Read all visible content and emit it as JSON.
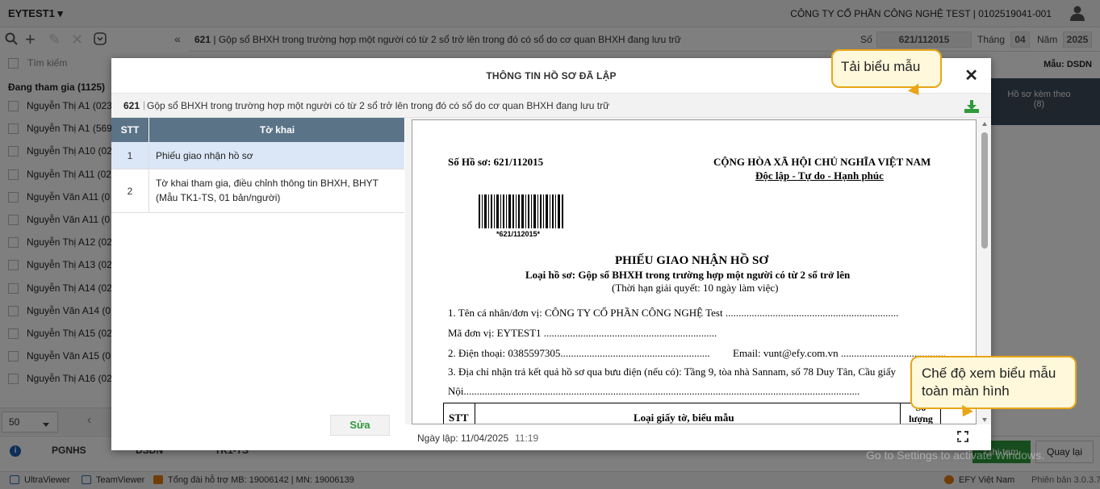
{
  "app": {
    "title": "EYTEST1",
    "company": "CÔNG TY CỔ PHẦN CÔNG NGHỆ TEST | 0102519041-001"
  },
  "doc_header": {
    "code": "621",
    "title": "Gộp sổ BHXH trong trường hợp một người có từ 2 sổ trở lên trong đó có sổ do cơ quan BHXH đang lưu trữ",
    "so_label": "Số",
    "so_value": "621/112015",
    "thang_label": "Tháng",
    "thang_value": "04",
    "nam_label": "Năm",
    "nam_value": "2025"
  },
  "sidebar": {
    "search_placeholder": "Tìm kiếm",
    "group_label": "Đang tham gia (1125)",
    "people": [
      "Nguyễn Thị A1 (023",
      "Nguyễn Thị A1 (569",
      "Nguyễn Thị A10 (02",
      "Nguyễn Thị A11 (02",
      "Nguyễn Văn A11 (0",
      "Nguyễn Văn A11 (0",
      "Nguyễn Thị A12 (02",
      "Nguyễn Thị A13 (02",
      "Nguyễn Thị A14 (02",
      "Nguyễn Văn A14 (0",
      "Nguyễn Thị A15 (02",
      "Nguyễn Văn A15 (0",
      "Nguyễn Thị A16 (02"
    ],
    "page_size": "50"
  },
  "right_pane": {
    "mau_label": "Mẫu: DSDN",
    "attach_label": "Hồ sơ kèm theo",
    "attach_count": "(8)"
  },
  "bottom_tabs": [
    "PGNHS",
    "DSDN",
    "TK1-TS"
  ],
  "bottom_buttons": {
    "save": "Ghi tạm",
    "back": "Quay lại"
  },
  "statusbar": {
    "ultraviewer": "UltraViewer",
    "teamviewer": "TeamViewer",
    "support": "Tổng đài hỗ trợ MB: 19006142 | MN: 19006139",
    "brand": "EFY Việt Nam",
    "version": "Phiên bản 3.0.3.7"
  },
  "modal": {
    "title": "THÔNG TIN HỒ SƠ ĐÃ LẬP",
    "sub_code": "621",
    "sub_text": "Gộp sổ BHXH trong trường hợp một người có từ 2 sổ trở lên trong đó có sổ do cơ quan BHXH đang lưu trữ",
    "table": {
      "headers": [
        "STT",
        "Tờ khai"
      ],
      "rows": [
        {
          "stt": "1",
          "name": "Phiếu giao nhận hồ sơ"
        },
        {
          "stt": "2",
          "name": "Tờ khai tham gia, điều chỉnh thông tin BHXH, BHYT (Mẫu TK1-TS, 01 bản/người)"
        }
      ]
    },
    "edit_button": "Sửa",
    "footer": {
      "date_label": "Ngày lập: 11/04/2025",
      "time": "11:19"
    }
  },
  "document": {
    "so_ho_so": "Số Hồ sơ: 621/112015",
    "nation": "CỘNG HÒA XÃ HỘI CHỦ NGHĨA VIỆT NAM",
    "motto": "Độc lập - Tự do - Hạnh phúc",
    "barcode_text": "*621/112015*",
    "title": "PHIẾU GIAO NHẬN HỒ SƠ",
    "type_line": "Loại hồ sơ: Gộp sổ BHXH trong trường hợp một người có từ 2 sổ trở lên",
    "deadline": "(Thời hạn giải quyết: 10 ngày làm việc)",
    "line1": "1. Tên cá nhân/đơn vị: CÔNG TY CỔ PHẦN CÔNG NGHỆ Test ..................................................................",
    "line2": "Mã đơn vị: EYTEST1 ..................................................................",
    "line3a": "2. Điện thoại: 0385597305.........................................................",
    "line3b": "Email: vunt@efy.com.vn ........................................",
    "line4": "3. Địa chỉ nhận trả kết quả hồ sơ qua bưu điện (nếu có): Tầng 9, tòa nhà Sannam, số 78 Duy Tân, Cầu giấy",
    "line5": "Nội.......................................................................................................................................................",
    "table_headers": [
      "STT",
      "Loại giấy tờ, biểu mẫu",
      "Số lượng"
    ]
  },
  "callouts": {
    "download": "Tải biểu mẫu",
    "fullscreen": "Chế độ xem biểu mẫu toàn màn hình"
  },
  "watermark": {
    "line1": "Activate Windows",
    "line2": "Go to Settings to activate Windows."
  }
}
